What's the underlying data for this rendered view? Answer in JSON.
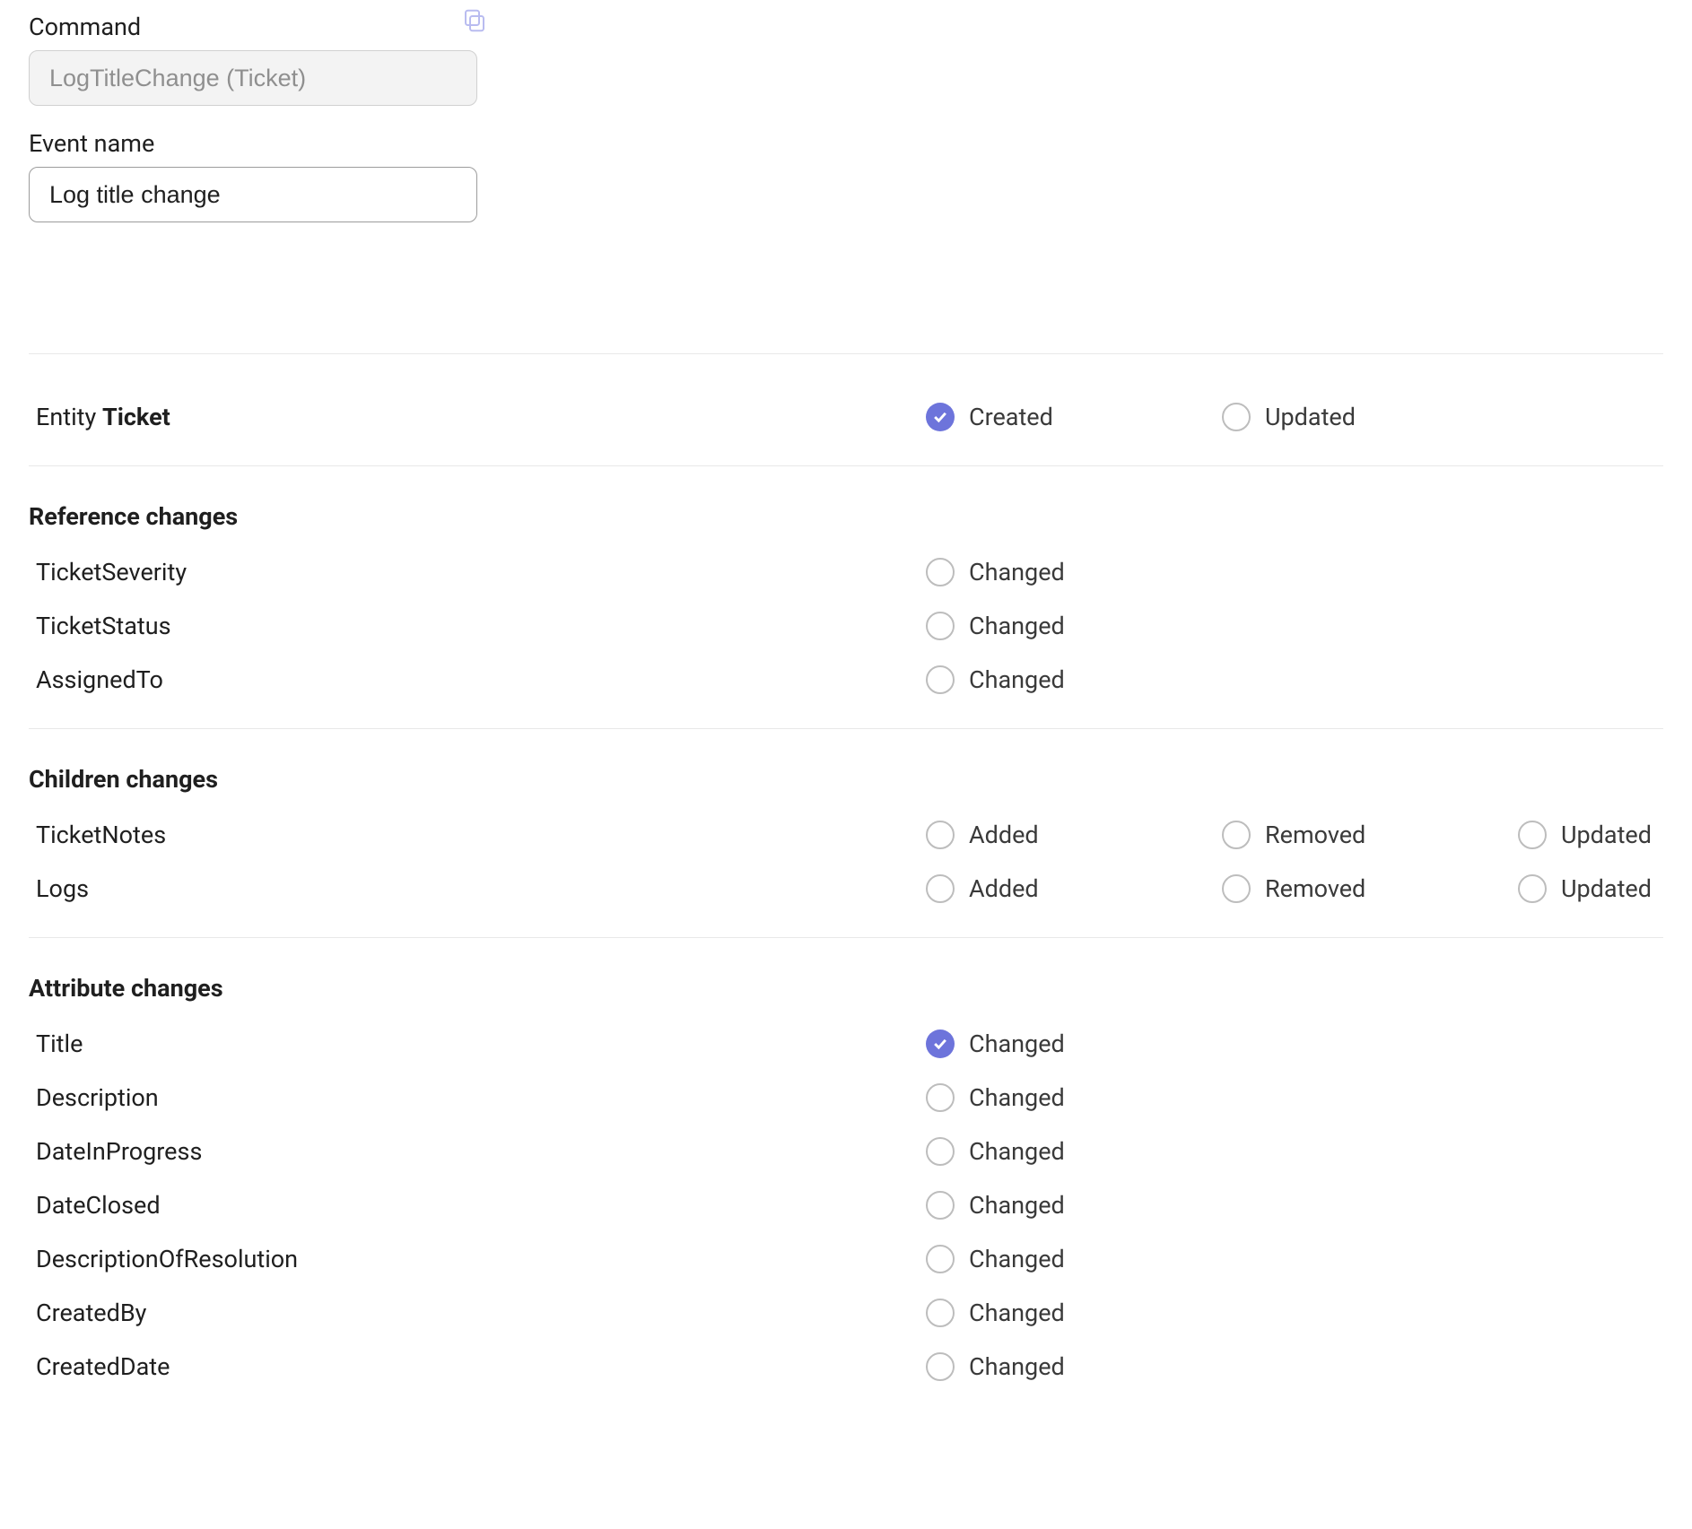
{
  "fields": {
    "command_label": "Command",
    "command_value": "LogTitleChange (Ticket)",
    "eventname_label": "Event name",
    "eventname_value": "Log title change"
  },
  "entity": {
    "prefix": "Entity",
    "name": "Ticket",
    "options": {
      "created": "Created",
      "updated": "Updated"
    },
    "selected": "created"
  },
  "reference_changes": {
    "title": "Reference changes",
    "option_changed": "Changed",
    "rows": [
      {
        "name": "TicketSeverity",
        "changed": false
      },
      {
        "name": "TicketStatus",
        "changed": false
      },
      {
        "name": "AssignedTo",
        "changed": false
      }
    ]
  },
  "children_changes": {
    "title": "Children changes",
    "option_added": "Added",
    "option_removed": "Removed",
    "option_updated": "Updated",
    "rows": [
      {
        "name": "TicketNotes",
        "added": false,
        "removed": false,
        "updated": false
      },
      {
        "name": "Logs",
        "added": false,
        "removed": false,
        "updated": false
      }
    ]
  },
  "attribute_changes": {
    "title": "Attribute changes",
    "option_changed": "Changed",
    "rows": [
      {
        "name": "Title",
        "changed": true
      },
      {
        "name": "Description",
        "changed": false
      },
      {
        "name": "DateInProgress",
        "changed": false
      },
      {
        "name": "DateClosed",
        "changed": false
      },
      {
        "name": "DescriptionOfResolution",
        "changed": false
      },
      {
        "name": "CreatedBy",
        "changed": false
      },
      {
        "name": "CreatedDate",
        "changed": false
      }
    ]
  }
}
